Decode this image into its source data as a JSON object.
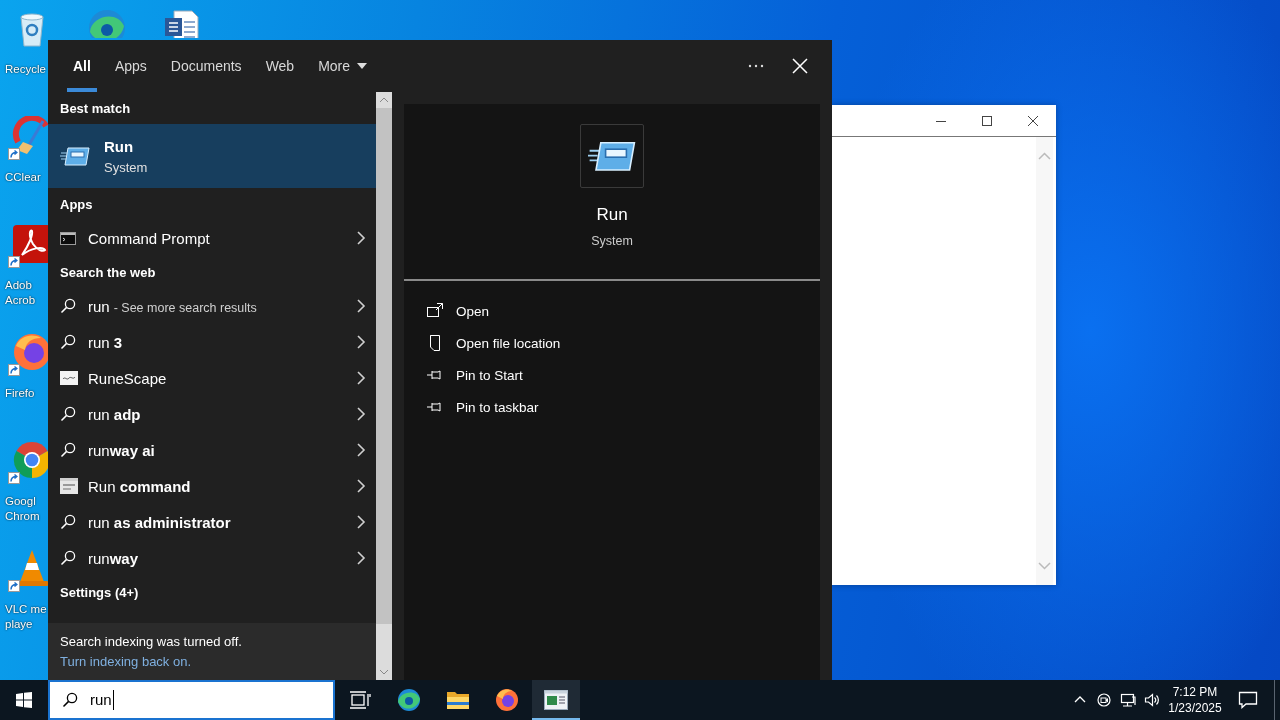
{
  "desktop_icons": [
    {
      "kind": "recycle-bin",
      "label_lines": [
        "Recycle"
      ],
      "shortcut": false
    },
    {
      "kind": "edge"
    },
    {
      "kind": "word"
    },
    {
      "kind": "ccleaner",
      "label_lines": [
        "CClear"
      ],
      "shortcut": true
    },
    {
      "kind": "acrobat",
      "label_lines": [
        "Adob",
        "Acrob"
      ],
      "shortcut": true
    },
    {
      "kind": "firefox",
      "label_lines": [
        "Firefo"
      ],
      "shortcut": true
    },
    {
      "kind": "chrome",
      "label_lines": [
        "Googl",
        "Chrom"
      ],
      "shortcut": true
    },
    {
      "kind": "vlc",
      "label_lines": [
        "VLC me",
        "playe"
      ],
      "shortcut": true
    }
  ],
  "search_panel": {
    "tabs": [
      {
        "label": "All",
        "selected": true,
        "dropdown": false
      },
      {
        "label": "Apps",
        "selected": false,
        "dropdown": false
      },
      {
        "label": "Documents",
        "selected": false,
        "dropdown": false
      },
      {
        "label": "Web",
        "selected": false,
        "dropdown": false
      },
      {
        "label": "More",
        "selected": false,
        "dropdown": true
      }
    ],
    "sections": [
      {
        "kind": "best_match",
        "heading": "Best match",
        "items": [
          {
            "kind": "run",
            "label": "Run",
            "subtitle": "System",
            "selected": true
          }
        ]
      },
      {
        "kind": "apps",
        "heading": "Apps",
        "items": [
          {
            "kind": "console",
            "label": "Command Prompt",
            "selected": false
          }
        ]
      },
      {
        "kind": "web",
        "heading": "Search the web",
        "items": [
          {
            "kind": "search",
            "label": "run",
            "hint": "- See more search results",
            "selected": false
          },
          {
            "kind": "search",
            "label": "run **3**",
            "selected": false
          },
          {
            "kind": "thumbnail",
            "label": "RuneScape",
            "selected": false
          },
          {
            "kind": "search",
            "label": "run **adp**",
            "selected": false
          },
          {
            "kind": "search",
            "label": "run**way ai**",
            "selected": false
          },
          {
            "kind": "window-thumbnail",
            "label": "Run **command**",
            "selected": false
          },
          {
            "kind": "search",
            "label": "run **as administrator**",
            "selected": false
          },
          {
            "kind": "search",
            "label": "run**way**",
            "selected": false
          }
        ]
      },
      {
        "kind": "settings",
        "heading": "Settings (4+)"
      }
    ],
    "notice": {
      "text": "Search indexing was turned off.",
      "link": "Turn indexing back on."
    },
    "preview": {
      "title": "Run",
      "subtitle": "System",
      "actions": [
        {
          "kind": "open",
          "label": "Open"
        },
        {
          "kind": "file-location",
          "label": "Open file location"
        },
        {
          "kind": "pin",
          "label": "Pin to Start"
        },
        {
          "kind": "pin",
          "label": "Pin to taskbar"
        }
      ]
    }
  },
  "search_box": {
    "value": "run"
  },
  "taskbar": {
    "apps": [
      {
        "kind": "task-view",
        "active": false
      },
      {
        "kind": "edge",
        "active": false
      },
      {
        "kind": "explorer",
        "active": false
      },
      {
        "kind": "firefox",
        "active": false
      },
      {
        "kind": "run",
        "active": true
      }
    ],
    "clock": {
      "time": "7:12 PM",
      "date": "1/23/2025"
    }
  }
}
